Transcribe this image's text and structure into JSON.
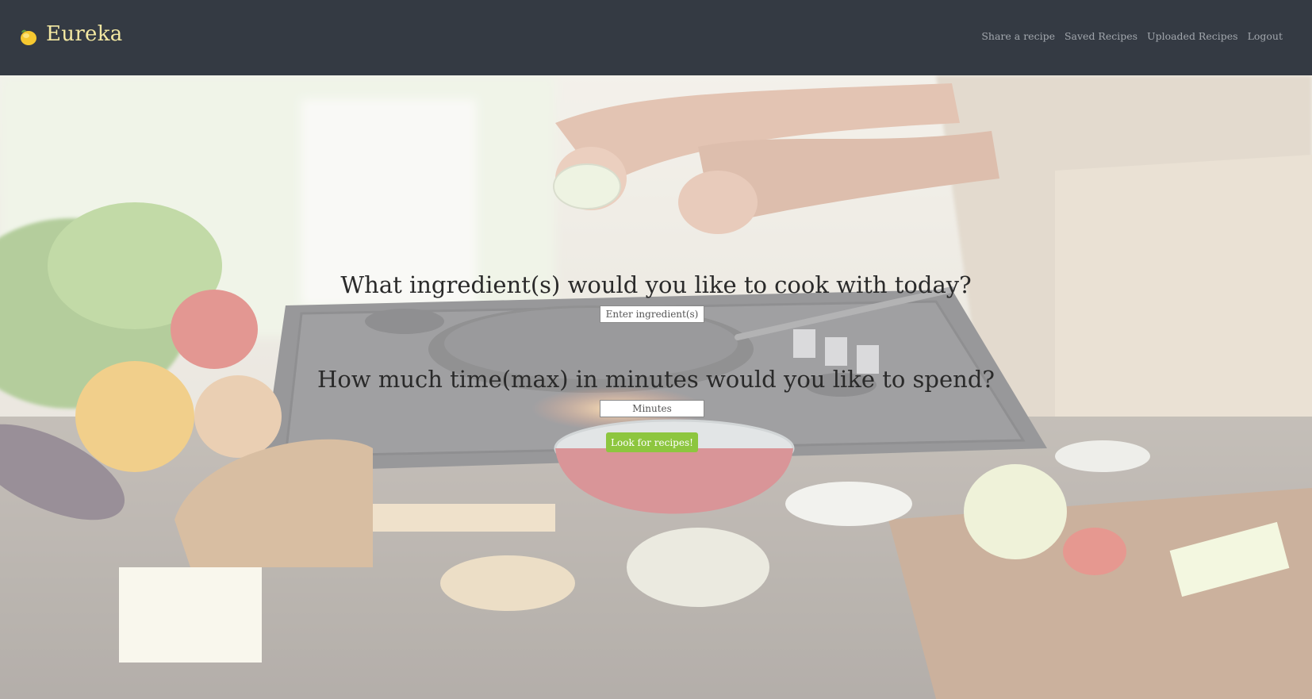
{
  "brand": {
    "name": "Eureka",
    "icon": "lemon-icon"
  },
  "nav": {
    "links": [
      "Share a recipe",
      "Saved Recipes",
      "Uploaded Recipes",
      "Logout"
    ]
  },
  "search": {
    "ingredient_question": "What ingredient(s) would you like to cook with today?",
    "ingredient_placeholder": "Enter ingredient(s)",
    "time_question": "How much time(max) in minutes would you like to spend?",
    "time_placeholder": "Minutes",
    "submit_label": "Look for recipes!"
  },
  "colors": {
    "navbar": "#343a43",
    "brand": "#f3e8a2",
    "nav_link": "#a2a7ad",
    "button": "#8dc63f"
  }
}
